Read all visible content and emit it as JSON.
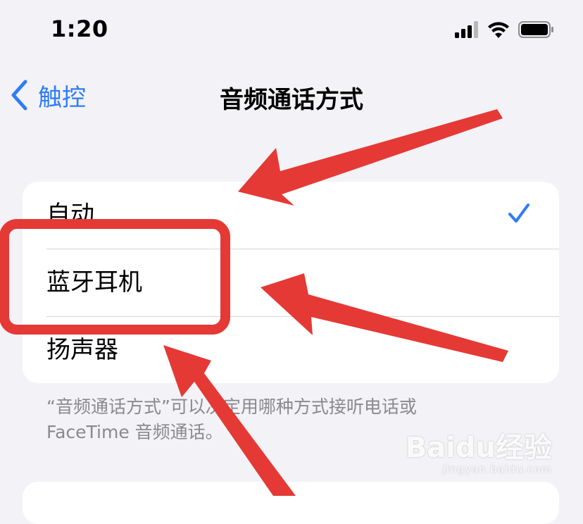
{
  "status_bar": {
    "time": "1:20",
    "signal_icon": "cellular-signal-icon",
    "wifi_icon": "wifi-icon",
    "battery_icon": "battery-icon"
  },
  "nav": {
    "back_label": "触控",
    "title": "音频通话方式"
  },
  "options": [
    {
      "label": "自动",
      "selected": true
    },
    {
      "label": "蓝牙耳机",
      "selected": false
    },
    {
      "label": "扬声器",
      "selected": false
    }
  ],
  "footnote": {
    "line1": "“音频通话方式”可以决定用哪种方式接听电话或",
    "line2": "FaceTime 音频通话。"
  },
  "colors": {
    "accent": "#2f7cf6",
    "annotation_red": "#e53935",
    "background": "#f2f2f7"
  },
  "watermark": {
    "logo": "Baidu经验",
    "url": "jingyan.baidu.com"
  }
}
